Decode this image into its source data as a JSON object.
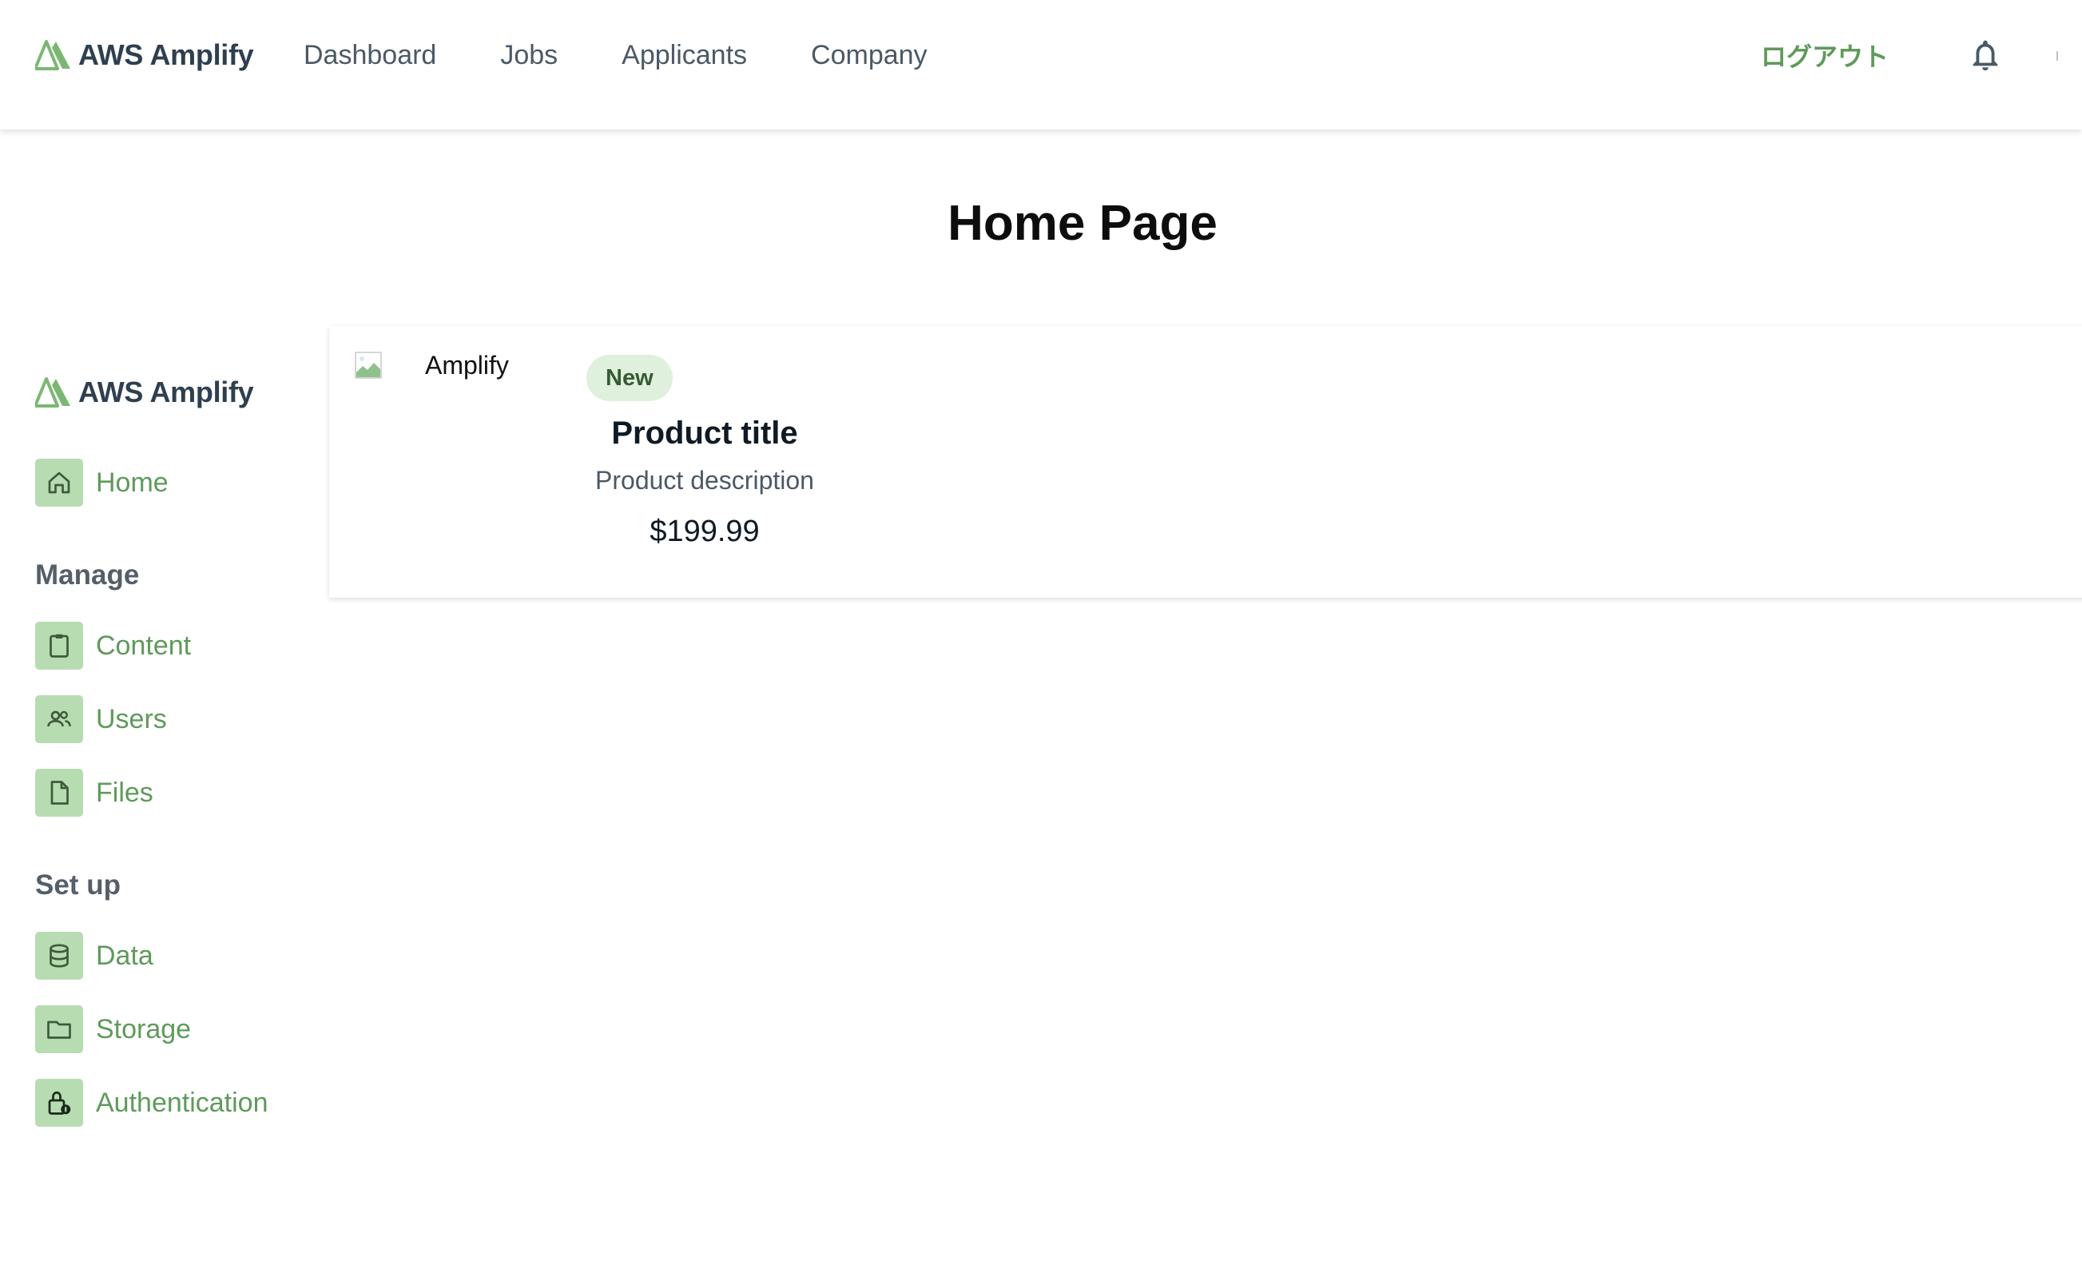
{
  "brand": {
    "name": "AWS Amplify",
    "logo_icon": "aws-amplify-logo",
    "accent_color": "#5e9a5a"
  },
  "header": {
    "nav_links": [
      "Dashboard",
      "Jobs",
      "Applicants",
      "Company"
    ],
    "logout_label": "ログアウト",
    "notification_icon": "bell-icon"
  },
  "page": {
    "title": "Home Page"
  },
  "sidebar": {
    "home": {
      "label": "Home",
      "icon": "home-icon"
    },
    "sections": [
      {
        "heading": "Manage",
        "items": [
          {
            "label": "Content",
            "icon": "clipboard-icon"
          },
          {
            "label": "Users",
            "icon": "users-icon"
          },
          {
            "label": "Files",
            "icon": "file-icon"
          }
        ]
      },
      {
        "heading": "Set up",
        "items": [
          {
            "label": "Data",
            "icon": "database-icon"
          },
          {
            "label": "Storage",
            "icon": "folder-icon"
          },
          {
            "label": "Authentication",
            "icon": "lock-icon"
          }
        ]
      }
    ]
  },
  "product_card": {
    "image_alt": "Amplify",
    "badge": "New",
    "title": "Product title",
    "description": "Product description",
    "price": "$199.99"
  }
}
